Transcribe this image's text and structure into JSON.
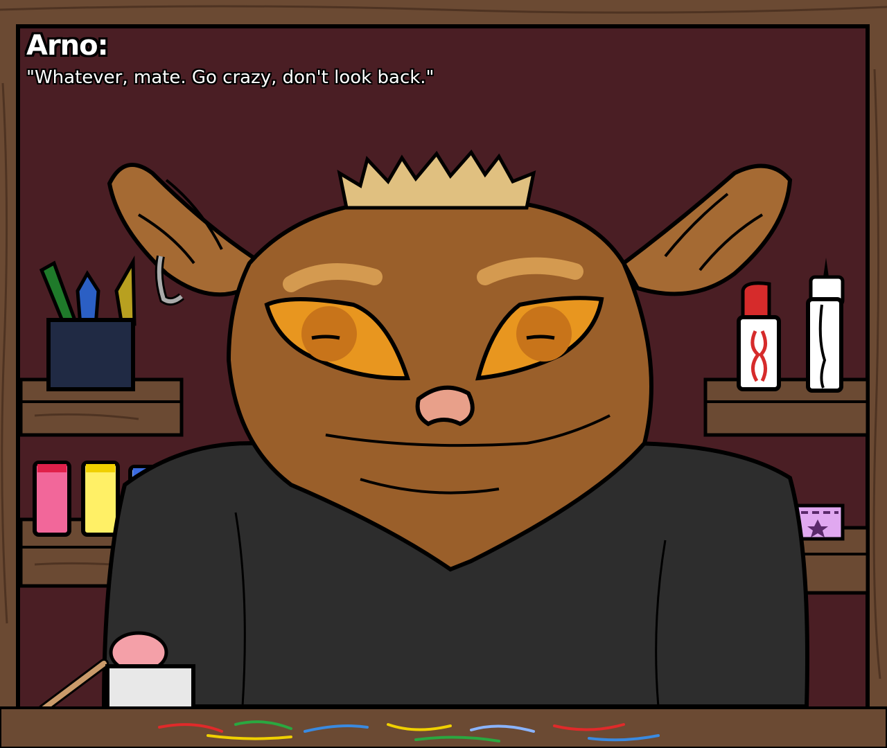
{
  "dialogue": {
    "speaker": "Arno:",
    "line": "\"Whatever, mate. Go crazy, don't look back.\""
  },
  "scene": {
    "character": "tarsier",
    "palette": {
      "wall": "#4a1e24",
      "wood": "#6b4a33",
      "fur": "#9a5f2a",
      "eye": "#e8961f",
      "shirt": "#2d2d2d",
      "nose": "#e8a08a"
    }
  }
}
